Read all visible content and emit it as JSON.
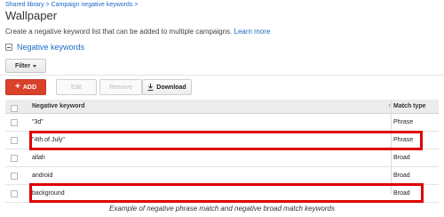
{
  "breadcrumb": "Shared library > Campaign negative keywords >",
  "page_title": "Wallpaper",
  "description": "Create a negative keyword list that can be added to multiple campaigns.",
  "learn_more": "Learn more",
  "section_label": "Negative keywords",
  "toolbar": {
    "filter_label": "Filter",
    "add_label": "ADD",
    "edit_label": "Edit",
    "remove_label": "Remove",
    "download_label": "Download"
  },
  "table": {
    "headers": {
      "keyword": "Negative keyword",
      "sort_glyph": "↑",
      "match_type": "Match type"
    },
    "rows": [
      {
        "keyword": "\"3d\"",
        "match_type": "Phrase"
      },
      {
        "keyword": "\"4th of July\"",
        "match_type": "Phrase"
      },
      {
        "keyword": "allah",
        "match_type": "Broad"
      },
      {
        "keyword": "android",
        "match_type": "Broad"
      },
      {
        "keyword": "background",
        "match_type": "Broad"
      }
    ]
  },
  "caption": "Example of negative phrase match and negative broad match keywords",
  "colors": {
    "link": "#1a6ac8",
    "add_button": "#d9412b",
    "highlight": "#dd0000"
  }
}
